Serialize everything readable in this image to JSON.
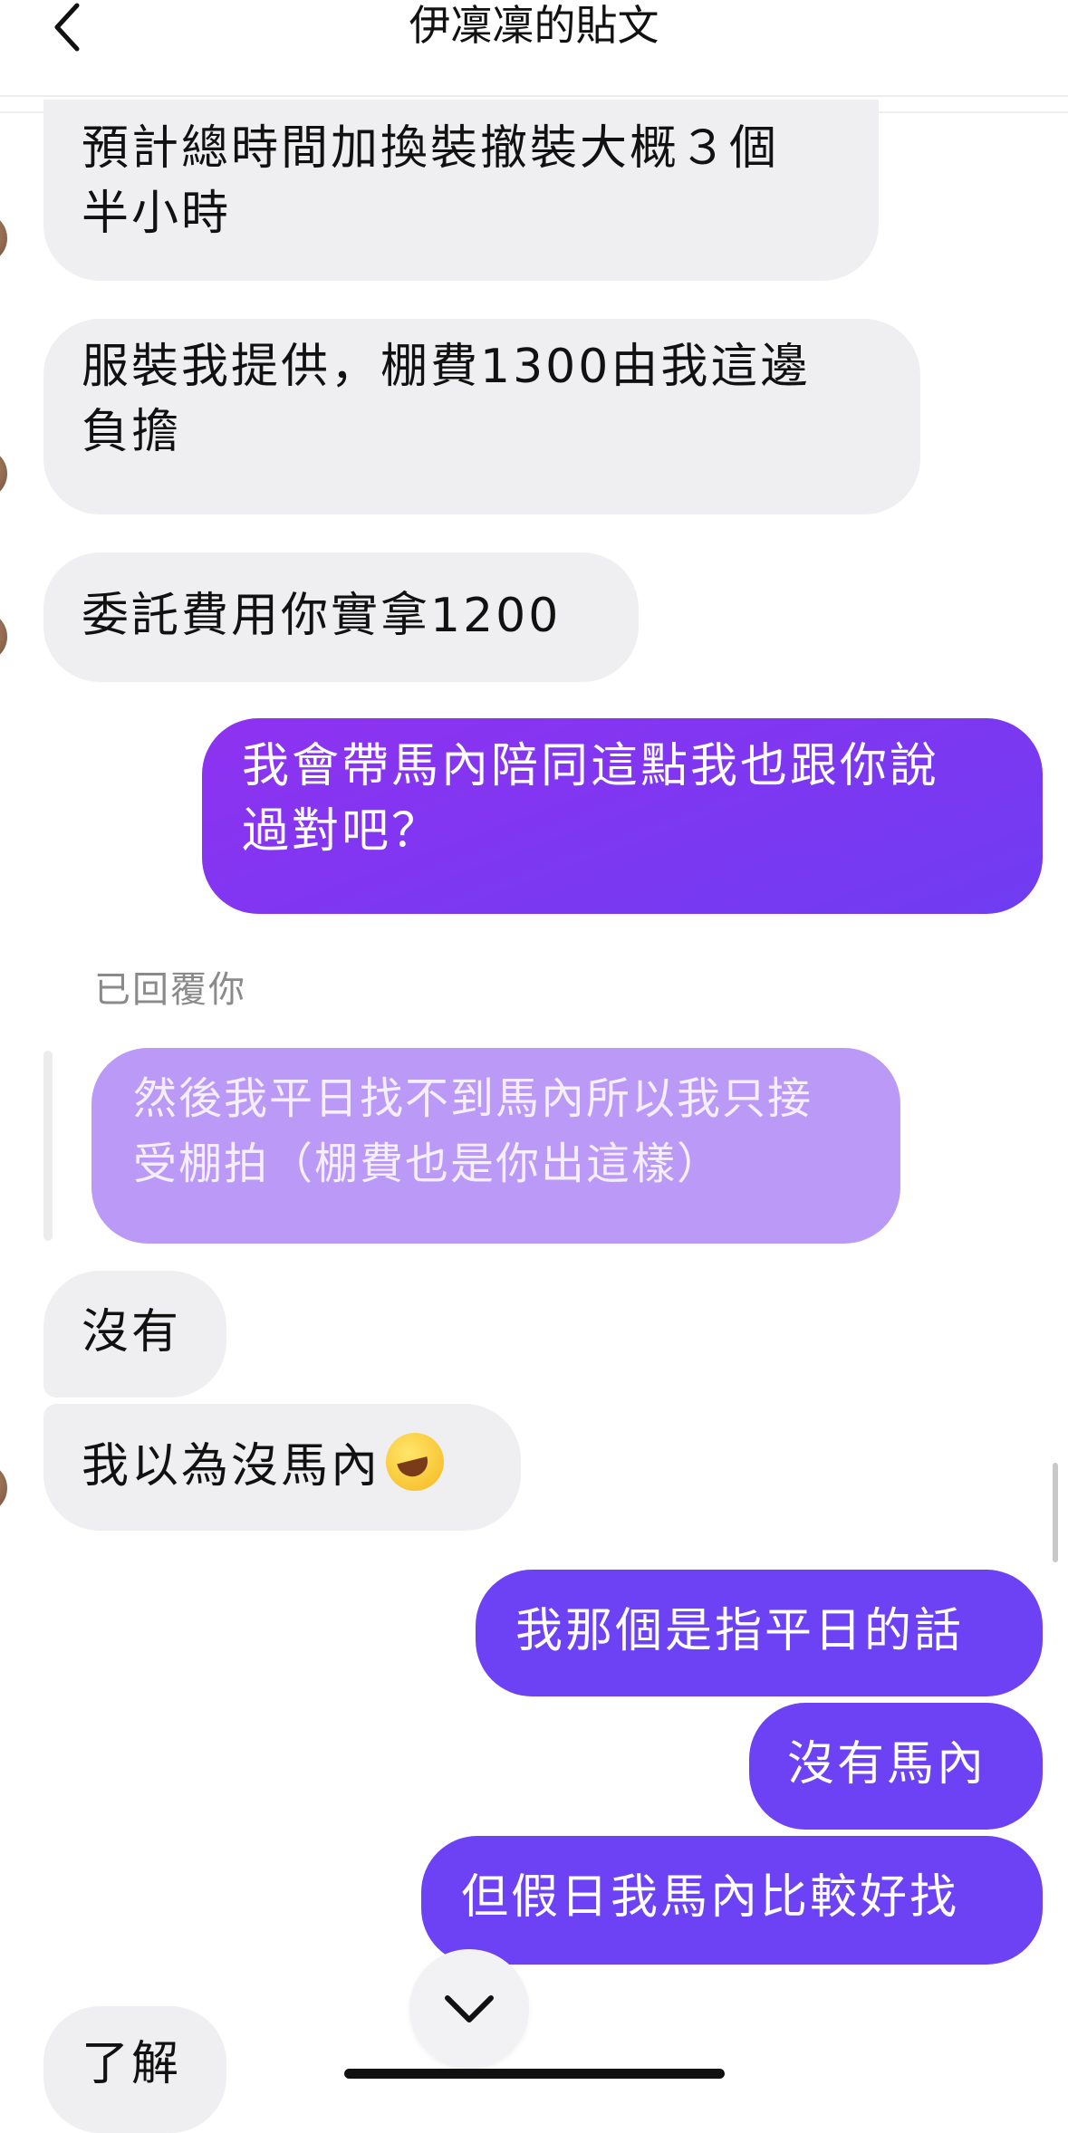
{
  "header": {
    "title": "伊凜凜的貼文",
    "back_icon": "chevron-left-icon"
  },
  "messages": [
    {
      "side": "in",
      "text1": "預計總時間加換裝撤裝大概３個",
      "text2": "半小時"
    },
    {
      "side": "in",
      "text1": "服裝我提供，棚費1300由我這邊",
      "text2": "負擔"
    },
    {
      "side": "in",
      "text1": "委託費用你實拿1200"
    },
    {
      "side": "out",
      "text1": "我會帶馬內陪同這點我也跟你說",
      "text2": "過對吧？"
    }
  ],
  "reply": {
    "label": "已回覆你",
    "quote_line1": "然後我平日找不到馬內所以我只接",
    "quote_line2": "受棚拍（棚費也是你出這樣）"
  },
  "messages2": [
    {
      "side": "in",
      "text": "沒有"
    },
    {
      "side": "in",
      "text": "我以為沒馬內",
      "emoji": "rolling-on-floor-laughing-emoji"
    },
    {
      "side": "out",
      "text": "我那個是指平日的話"
    },
    {
      "side": "out",
      "text": "沒有馬內"
    },
    {
      "side": "out",
      "text": "但假日我馬內比較好找"
    },
    {
      "side": "in",
      "text": "了解"
    }
  ],
  "colors": {
    "incoming_bg": "#efeff1",
    "outgoing_purple": "#8e32f0",
    "outgoing_indigo": "#6d42f4",
    "quote_bg": "#bb9af7"
  }
}
